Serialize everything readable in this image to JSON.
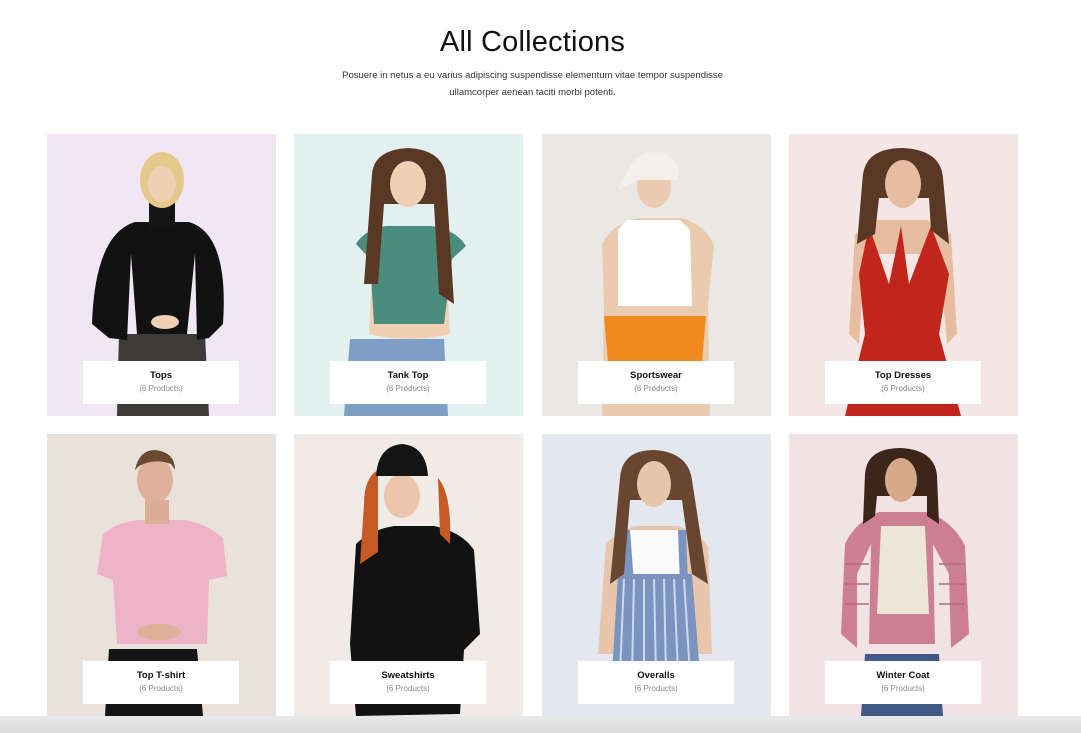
{
  "header": {
    "title": "All Collections",
    "subtitle": "Posuere in netus a eu varius adipiscing suspendisse elementum vitae tempor suspendisse ullamcorper aenean taciti morbi potenti."
  },
  "collections": [
    {
      "name": "Tops",
      "count": "(6 Products)",
      "bg": "#f1e6f3"
    },
    {
      "name": "Tank Top",
      "count": "(6 Products)",
      "bg": "#e2f0ef"
    },
    {
      "name": "Sportswear",
      "count": "(6 Products)",
      "bg": "#e9e8e4"
    },
    {
      "name": "Top Dresses",
      "count": "(6 Products)",
      "bg": "#f5e6e6"
    },
    {
      "name": "Top T-shirt",
      "count": "(6 Products)",
      "bg": "#e8e2db"
    },
    {
      "name": "Sweatshirts",
      "count": "(6 Products)",
      "bg": "#f0ebe6"
    },
    {
      "name": "Overalls",
      "count": "(6 Products)",
      "bg": "#e3e8f0"
    },
    {
      "name": "Winter Coat",
      "count": "(6 Products)",
      "bg": "#f1e3e5"
    }
  ]
}
